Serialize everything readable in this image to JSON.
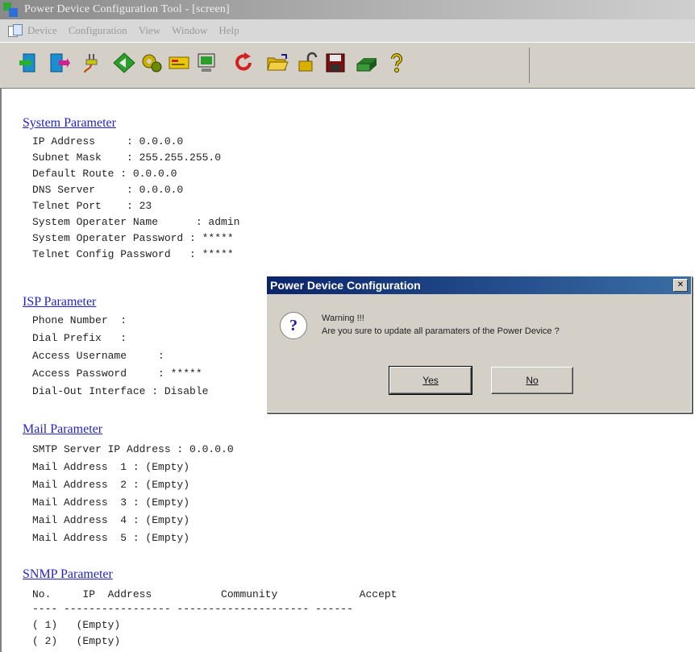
{
  "window": {
    "title": "Power Device Configuration Tool - [screen]"
  },
  "menu": {
    "items": [
      "Device",
      "Configuration",
      "View",
      "Window",
      "Help"
    ]
  },
  "toolbar": {
    "buttons": [
      {
        "icon": "enter-door-icon",
        "color": "#1a8fd0"
      },
      {
        "icon": "exit-door-icon",
        "color": "#d01a8f"
      },
      {
        "icon": "plug-icon",
        "color": "#8a8a00"
      },
      {
        "icon": "diamond-arrow-icon",
        "color": "#2aa02a"
      },
      {
        "icon": "gears-icon",
        "color": "#6a6a00"
      },
      {
        "icon": "card-icon",
        "color": "#c8a000"
      },
      {
        "icon": "monitor-icon",
        "color": "#1aa01a"
      },
      {
        "icon": "refresh-icon",
        "color": "#d02020"
      },
      {
        "icon": "open-folder-icon",
        "color": "#d8b000"
      },
      {
        "icon": "unlock-icon",
        "color": "#d8b000"
      },
      {
        "icon": "save-disk-icon",
        "color": "#8a1a1a"
      },
      {
        "icon": "print-icon",
        "color": "#2a7a2a"
      },
      {
        "icon": "help-icon",
        "color": "#d8b000"
      }
    ]
  },
  "sections": {
    "system": {
      "heading": "System Parameter",
      "lines": [
        "IP Address     : 0.0.0.0",
        "Subnet Mask    : 255.255.255.0",
        "Default Route : 0.0.0.0",
        "DNS Server     : 0.0.0.0",
        "Telnet Port    : 23",
        "System Operater Name      : admin",
        "System Operater Password : *****",
        "Telnet Config Password   : *****"
      ]
    },
    "isp": {
      "heading": "ISP Parameter",
      "lines": [
        "Phone Number  :",
        "Dial Prefix   :",
        "Access Username     :",
        "Access Password     : *****",
        "Dial-Out Interface : Disable"
      ]
    },
    "mail": {
      "heading": "Mail Parameter",
      "lines": [
        "SMTP Server IP Address : 0.0.0.0",
        "Mail Address  1 : (Empty)",
        "Mail Address  2 : (Empty)",
        "Mail Address  3 : (Empty)",
        "Mail Address  4 : (Empty)",
        "Mail Address  5 : (Empty)"
      ]
    },
    "snmp": {
      "heading": "SNMP Parameter",
      "header_line": "No.     IP  Address           Community             Accept",
      "rule_line": "---- ----------------- --------------------- ------",
      "rows": [
        "( 1)   (Empty)",
        "( 2)   (Empty)"
      ]
    }
  },
  "dialog": {
    "title": "Power Device Configuration",
    "close_glyph": "✕",
    "icon_glyph": "?",
    "message_line1": "Warning !!!",
    "message_line2": "Are you sure to update all paramaters of the Power Device ?",
    "yes_label": "Yes",
    "no_label": "No"
  }
}
